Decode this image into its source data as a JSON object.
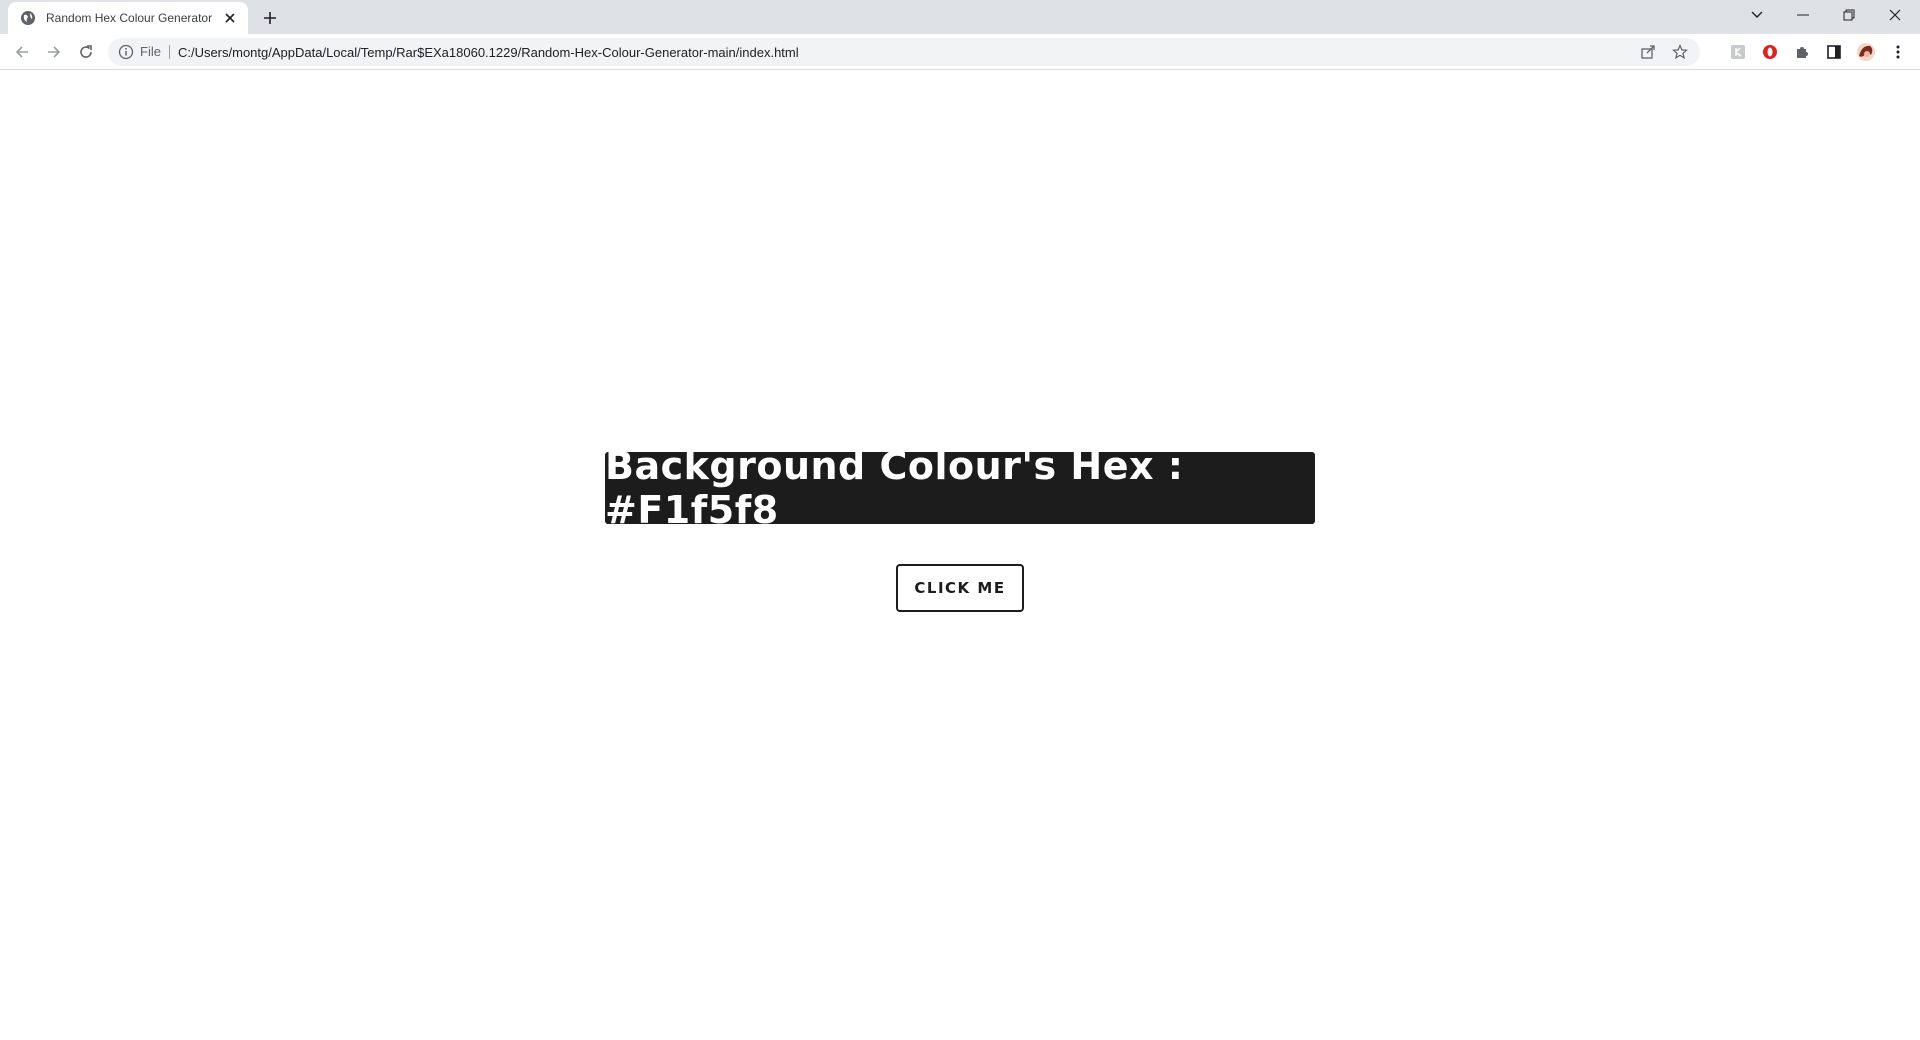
{
  "browser": {
    "tab": {
      "title": "Random Hex Colour Generator",
      "favicon": "globe-icon"
    },
    "address_bar": {
      "scheme_label": "File",
      "url": "C:/Users/montg/AppData/Local/Temp/Rar$EXa18060.1229/Random-Hex-Colour-Generator-main/index.html"
    },
    "toolbar_icons": [
      "back-icon",
      "forward-icon",
      "reload-icon",
      "share-icon",
      "star-icon",
      "extension-icon",
      "opera-icon",
      "puzzle-icon",
      "sidebar-icon",
      "profile-avatar",
      "menu-icon"
    ],
    "window_controls": [
      "tab-search-icon",
      "minimize-icon",
      "restore-icon",
      "close-window-icon"
    ]
  },
  "page": {
    "heading": "Background Colour's Hex : #F1f5f8",
    "button_label": "CLICK ME"
  },
  "colors": {
    "page_background": "#ffffff",
    "heading_background": "#1c1c1c",
    "heading_text": "#ffffff",
    "button_border": "#1c1c1c",
    "tabstrip": "#dee1e6"
  }
}
